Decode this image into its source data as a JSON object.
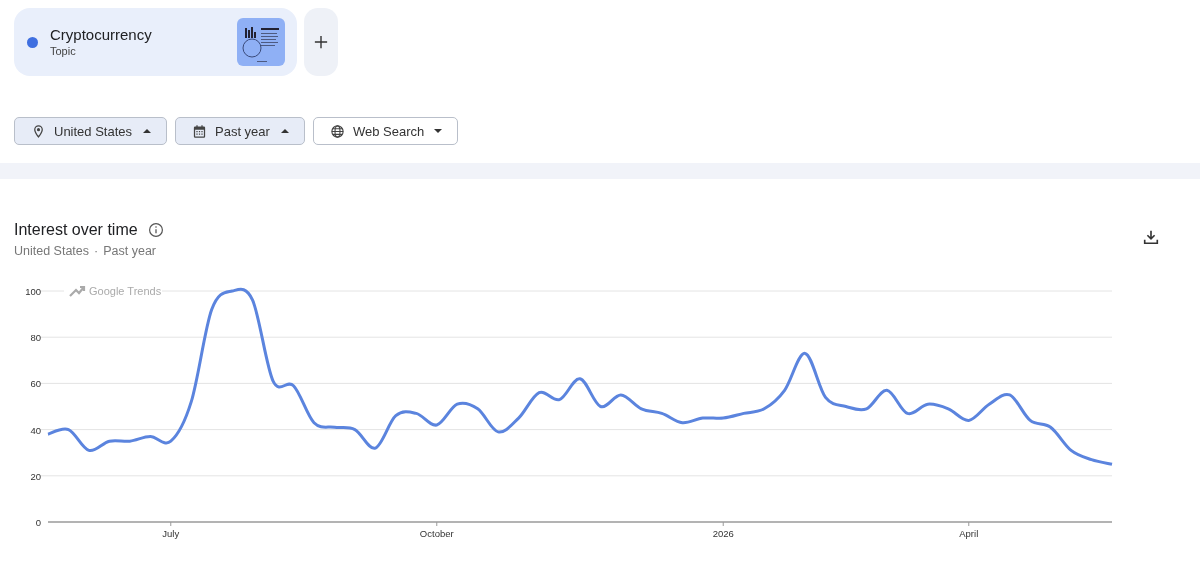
{
  "term": {
    "name": "Cryptocurrency",
    "type": "Topic",
    "color": "#3f6fe0"
  },
  "filters": [
    {
      "kind": "location",
      "label": "United States",
      "expanded": true
    },
    {
      "kind": "date",
      "label": "Past year",
      "expanded": true
    },
    {
      "kind": "property",
      "label": "Web Search",
      "expanded": false
    }
  ],
  "panel": {
    "title": "Interest over time",
    "subtitle_parts": [
      "United States",
      "·",
      "Past year"
    ],
    "watermark": "Google Trends",
    "chart_data": {
      "type": "line",
      "grid": true,
      "ylim": [
        0,
        100
      ],
      "yticks": [
        0,
        20,
        40,
        60,
        80,
        100
      ],
      "categories": [
        null,
        null,
        null,
        null,
        null,
        null,
        "July",
        null,
        null,
        null,
        null,
        null,
        null,
        null,
        null,
        null,
        null,
        null,
        null,
        "October",
        null,
        null,
        null,
        null,
        null,
        null,
        null,
        null,
        null,
        null,
        null,
        null,
        null,
        "2026",
        null,
        null,
        null,
        null,
        null,
        null,
        null,
        null,
        null,
        null,
        null,
        "April",
        null,
        null,
        null,
        null,
        null,
        null,
        null
      ],
      "series": [
        {
          "color": "#5b84de",
          "values": [
            38,
            40,
            31,
            35,
            35,
            37,
            35,
            52,
            92,
            100,
            96,
            61,
            59,
            43,
            41,
            40,
            32,
            46,
            47,
            42,
            51,
            49,
            39,
            45,
            56,
            53,
            62,
            50,
            55,
            49,
            47,
            43,
            45,
            45,
            47,
            49,
            57,
            73,
            54,
            50,
            49,
            57,
            47,
            51,
            49,
            44,
            51,
            55,
            44,
            41,
            31,
            27,
            25
          ]
        }
      ]
    }
  }
}
